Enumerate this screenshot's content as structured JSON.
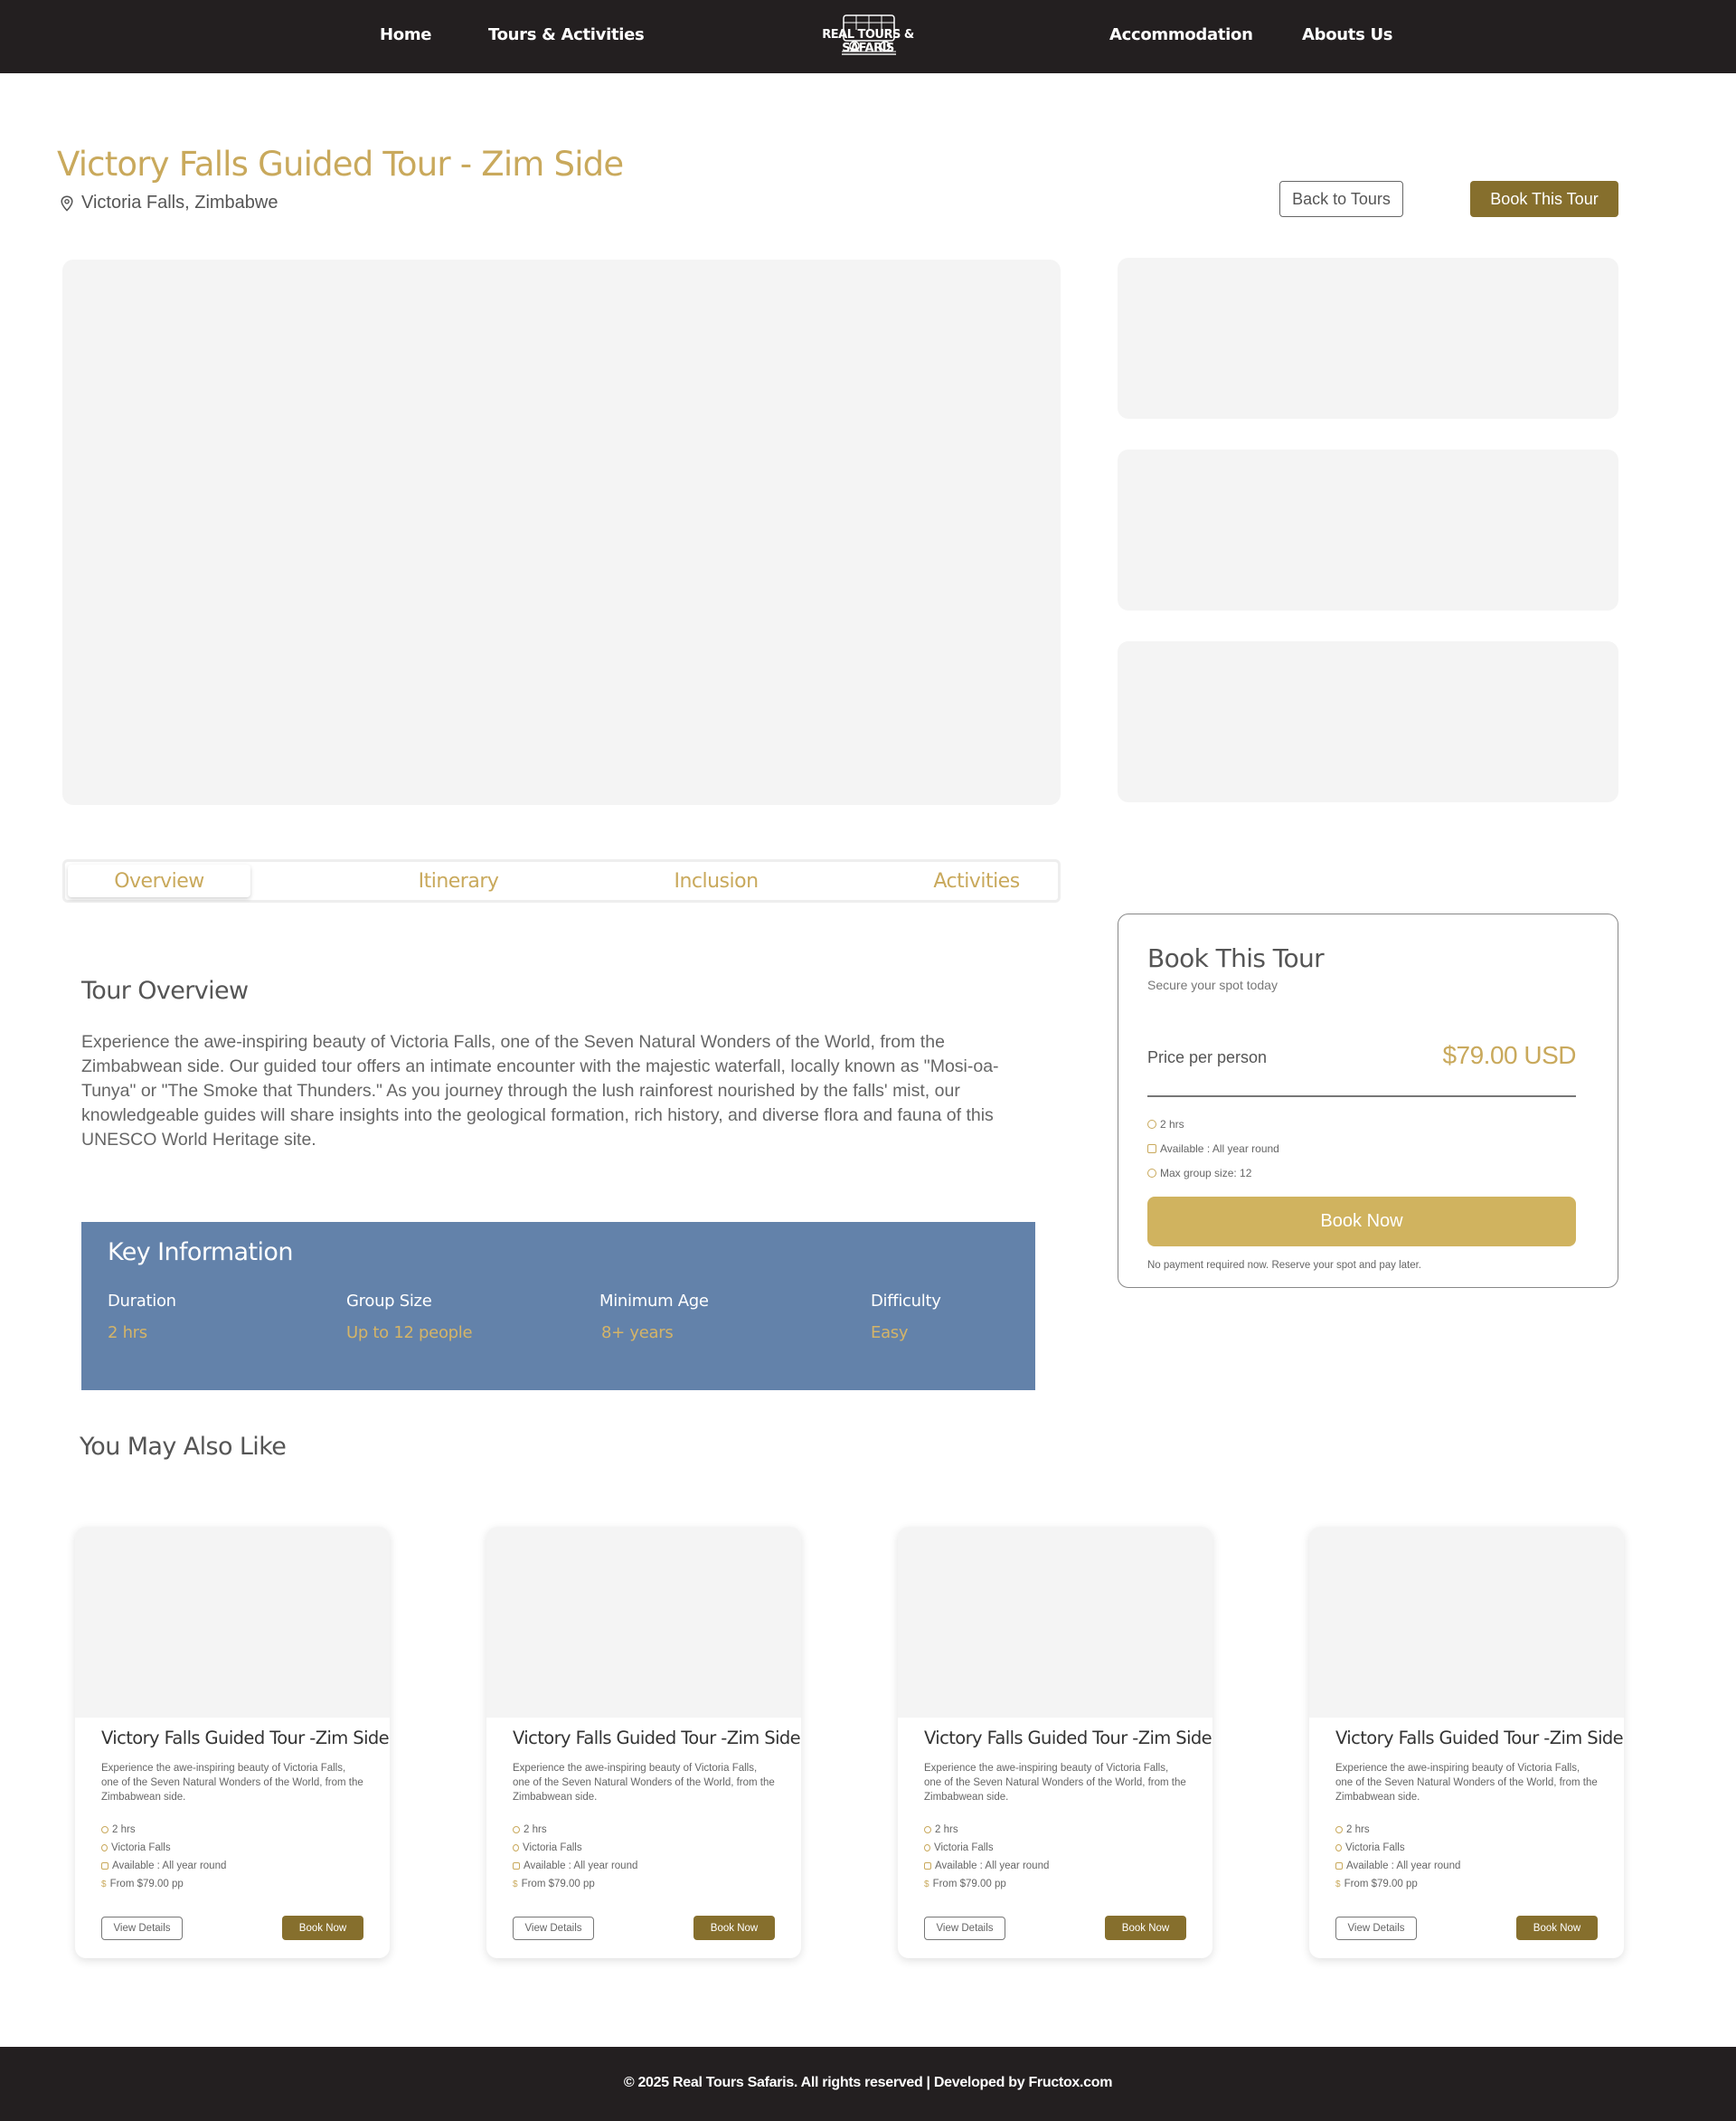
{
  "nav": {
    "home": "Home",
    "tours": "Tours & Activities",
    "logo": "REAL TOURS & SAFARIS",
    "accommodation": "Accommodation",
    "about": "Abouts Us"
  },
  "header": {
    "title": "Victory Falls Guided Tour - Zim Side",
    "location": "Victoria Falls, Zimbabwe",
    "back_label": "Back to Tours",
    "book_label": "Book This Tour"
  },
  "tabs": [
    "Overview",
    "Itinerary",
    "Inclusion",
    "Activities"
  ],
  "overview": {
    "heading": "Tour Overview",
    "text": "Experience the awe-inspiring beauty of Victoria Falls, one of the Seven Natural Wonders of the World, from the Zimbabwean side. Our guided tour offers an intimate encounter with the majestic waterfall, locally known as \"Mosi-oa-Tunya\" or \"The Smoke that Thunders.\" As you journey through the lush rainforest nourished by the falls' mist, our knowledgeable guides will share insights into the geological formation, rich history, and diverse flora and fauna of this UNESCO World Heritage site."
  },
  "key_info": {
    "title": "Key Information",
    "items": [
      {
        "label": "Duration",
        "value": "2 hrs"
      },
      {
        "label": "Group Size",
        "value": "Up to 12 people"
      },
      {
        "label": "Minimum Age",
        "value": "8+ years"
      },
      {
        "label": "Difficulty",
        "value": "Easy"
      }
    ]
  },
  "booking": {
    "title": "Book This Tour",
    "subtitle": "Secure your spot today",
    "price_label": "Price per person",
    "price": "$79.00 USD",
    "details": [
      "2 hrs",
      "Available : All year round",
      "Max group size: 12"
    ],
    "button": "Book Now",
    "note": "No payment required now. Reserve your spot and pay later."
  },
  "related": {
    "heading": "You May Also Like",
    "cards": [
      {
        "title": "Victory Falls Guided Tour -Zim Side",
        "desc": "Experience the awe-inspiring beauty of Victoria Falls, one of the Seven Natural Wonders of the World, from the Zimbabwean side.",
        "duration": "2 hrs",
        "location": "Victoria Falls",
        "availability": "Available : All year round",
        "price": "From $79.00 pp",
        "view": "View Details",
        "book": "Book Now"
      },
      {
        "title": "Victory Falls Guided Tour -Zim Side",
        "desc": "Experience the awe-inspiring beauty of Victoria Falls, one of the Seven Natural Wonders of the World, from the Zimbabwean side.",
        "duration": "2 hrs",
        "location": "Victoria Falls",
        "availability": "Available : All year round",
        "price": "From $79.00 pp",
        "view": "View Details",
        "book": "Book Now"
      },
      {
        "title": "Victory Falls Guided Tour -Zim Side",
        "desc": "Experience the awe-inspiring beauty of Victoria Falls, one of the Seven Natural Wonders of the World, from the Zimbabwean side.",
        "duration": "2 hrs",
        "location": "Victoria Falls",
        "availability": "Available : All year round",
        "price": "From $79.00 pp",
        "view": "View Details",
        "book": "Book Now"
      },
      {
        "title": "Victory Falls Guided Tour -Zim Side",
        "desc": "Experience the awe-inspiring beauty of Victoria Falls, one of the Seven Natural Wonders of the World, from the Zimbabwean side.",
        "duration": "2 hrs",
        "location": "Victoria Falls",
        "availability": "Available : All year round",
        "price": "From $79.00 pp",
        "view": "View Details",
        "book": "Book Now"
      }
    ]
  },
  "footer": {
    "text": "© 2025 Real Tours Safaris. All rights reserved | Developed by Fructox.com"
  },
  "colors": {
    "accent_gold": "#c9a95c",
    "button_dark_gold": "#866f2d",
    "nav_bg": "#231f20",
    "key_info_bg": "#6382aa"
  }
}
